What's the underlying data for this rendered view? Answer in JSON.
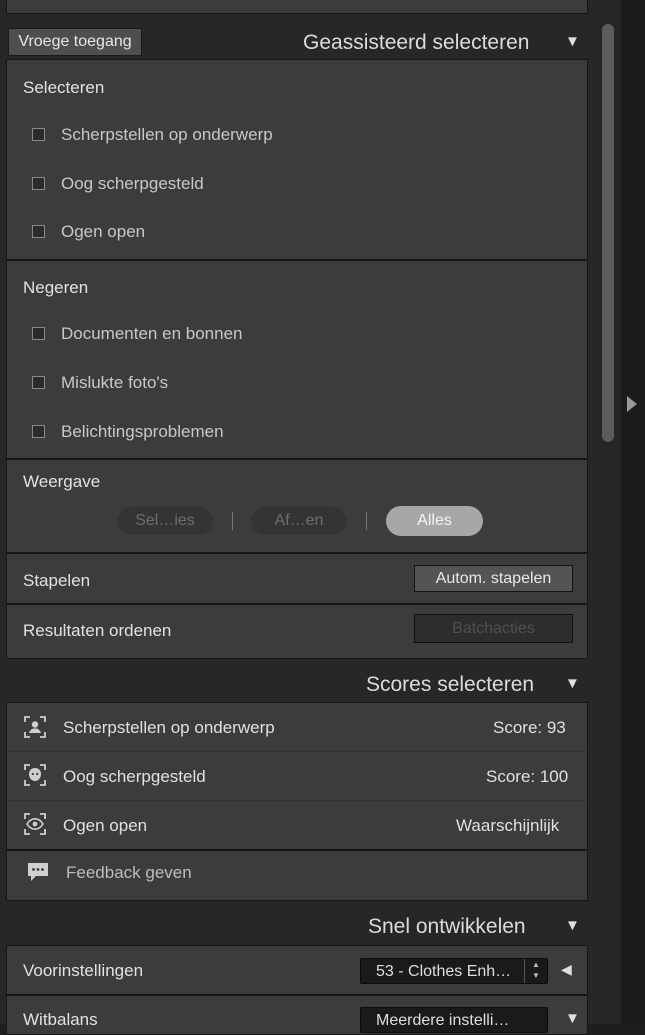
{
  "assisted": {
    "early_access_label": "Vroege toegang",
    "title": "Geassisteerd selecteren",
    "select": {
      "heading": "Selecteren",
      "items": [
        "Scherpstellen op onderwerp",
        "Oog scherpgesteld",
        "Ogen open"
      ]
    },
    "ignore": {
      "heading": "Negeren",
      "items": [
        "Documenten en bonnen",
        "Mislukte foto's",
        "Belichtingsproblemen"
      ]
    },
    "view": {
      "heading": "Weergave",
      "options": [
        "Sel…ies",
        "Af…en",
        "Alles"
      ],
      "selected": "Alles"
    },
    "stack": {
      "label": "Stapelen",
      "button": "Autom. stapelen"
    },
    "sort": {
      "label": "Resultaten ordenen",
      "button": "Batchacties"
    }
  },
  "scores": {
    "title": "Scores selecteren",
    "rows": [
      {
        "icon": "subject-focus-icon",
        "label": "Scherpstellen op onderwerp",
        "value": "Score: 93"
      },
      {
        "icon": "eye-focus-icon",
        "label": "Oog scherpgesteld",
        "value": "Score: 100"
      },
      {
        "icon": "eyes-open-icon",
        "label": "Ogen open",
        "value": "Waarschijnlijk"
      }
    ],
    "feedback_label": "Feedback geven"
  },
  "quick_develop": {
    "title": "Snel ontwikkelen",
    "preset_label": "Voorinstellingen",
    "preset_value": "53 - Clothes Enh…",
    "wb_label": "Witbalans",
    "wb_value": "Meerdere instelli…"
  },
  "colors": {
    "panel_bg": "#3c3c3c",
    "header_bg": "#272727",
    "selected_segment": "#a7a7a7"
  }
}
